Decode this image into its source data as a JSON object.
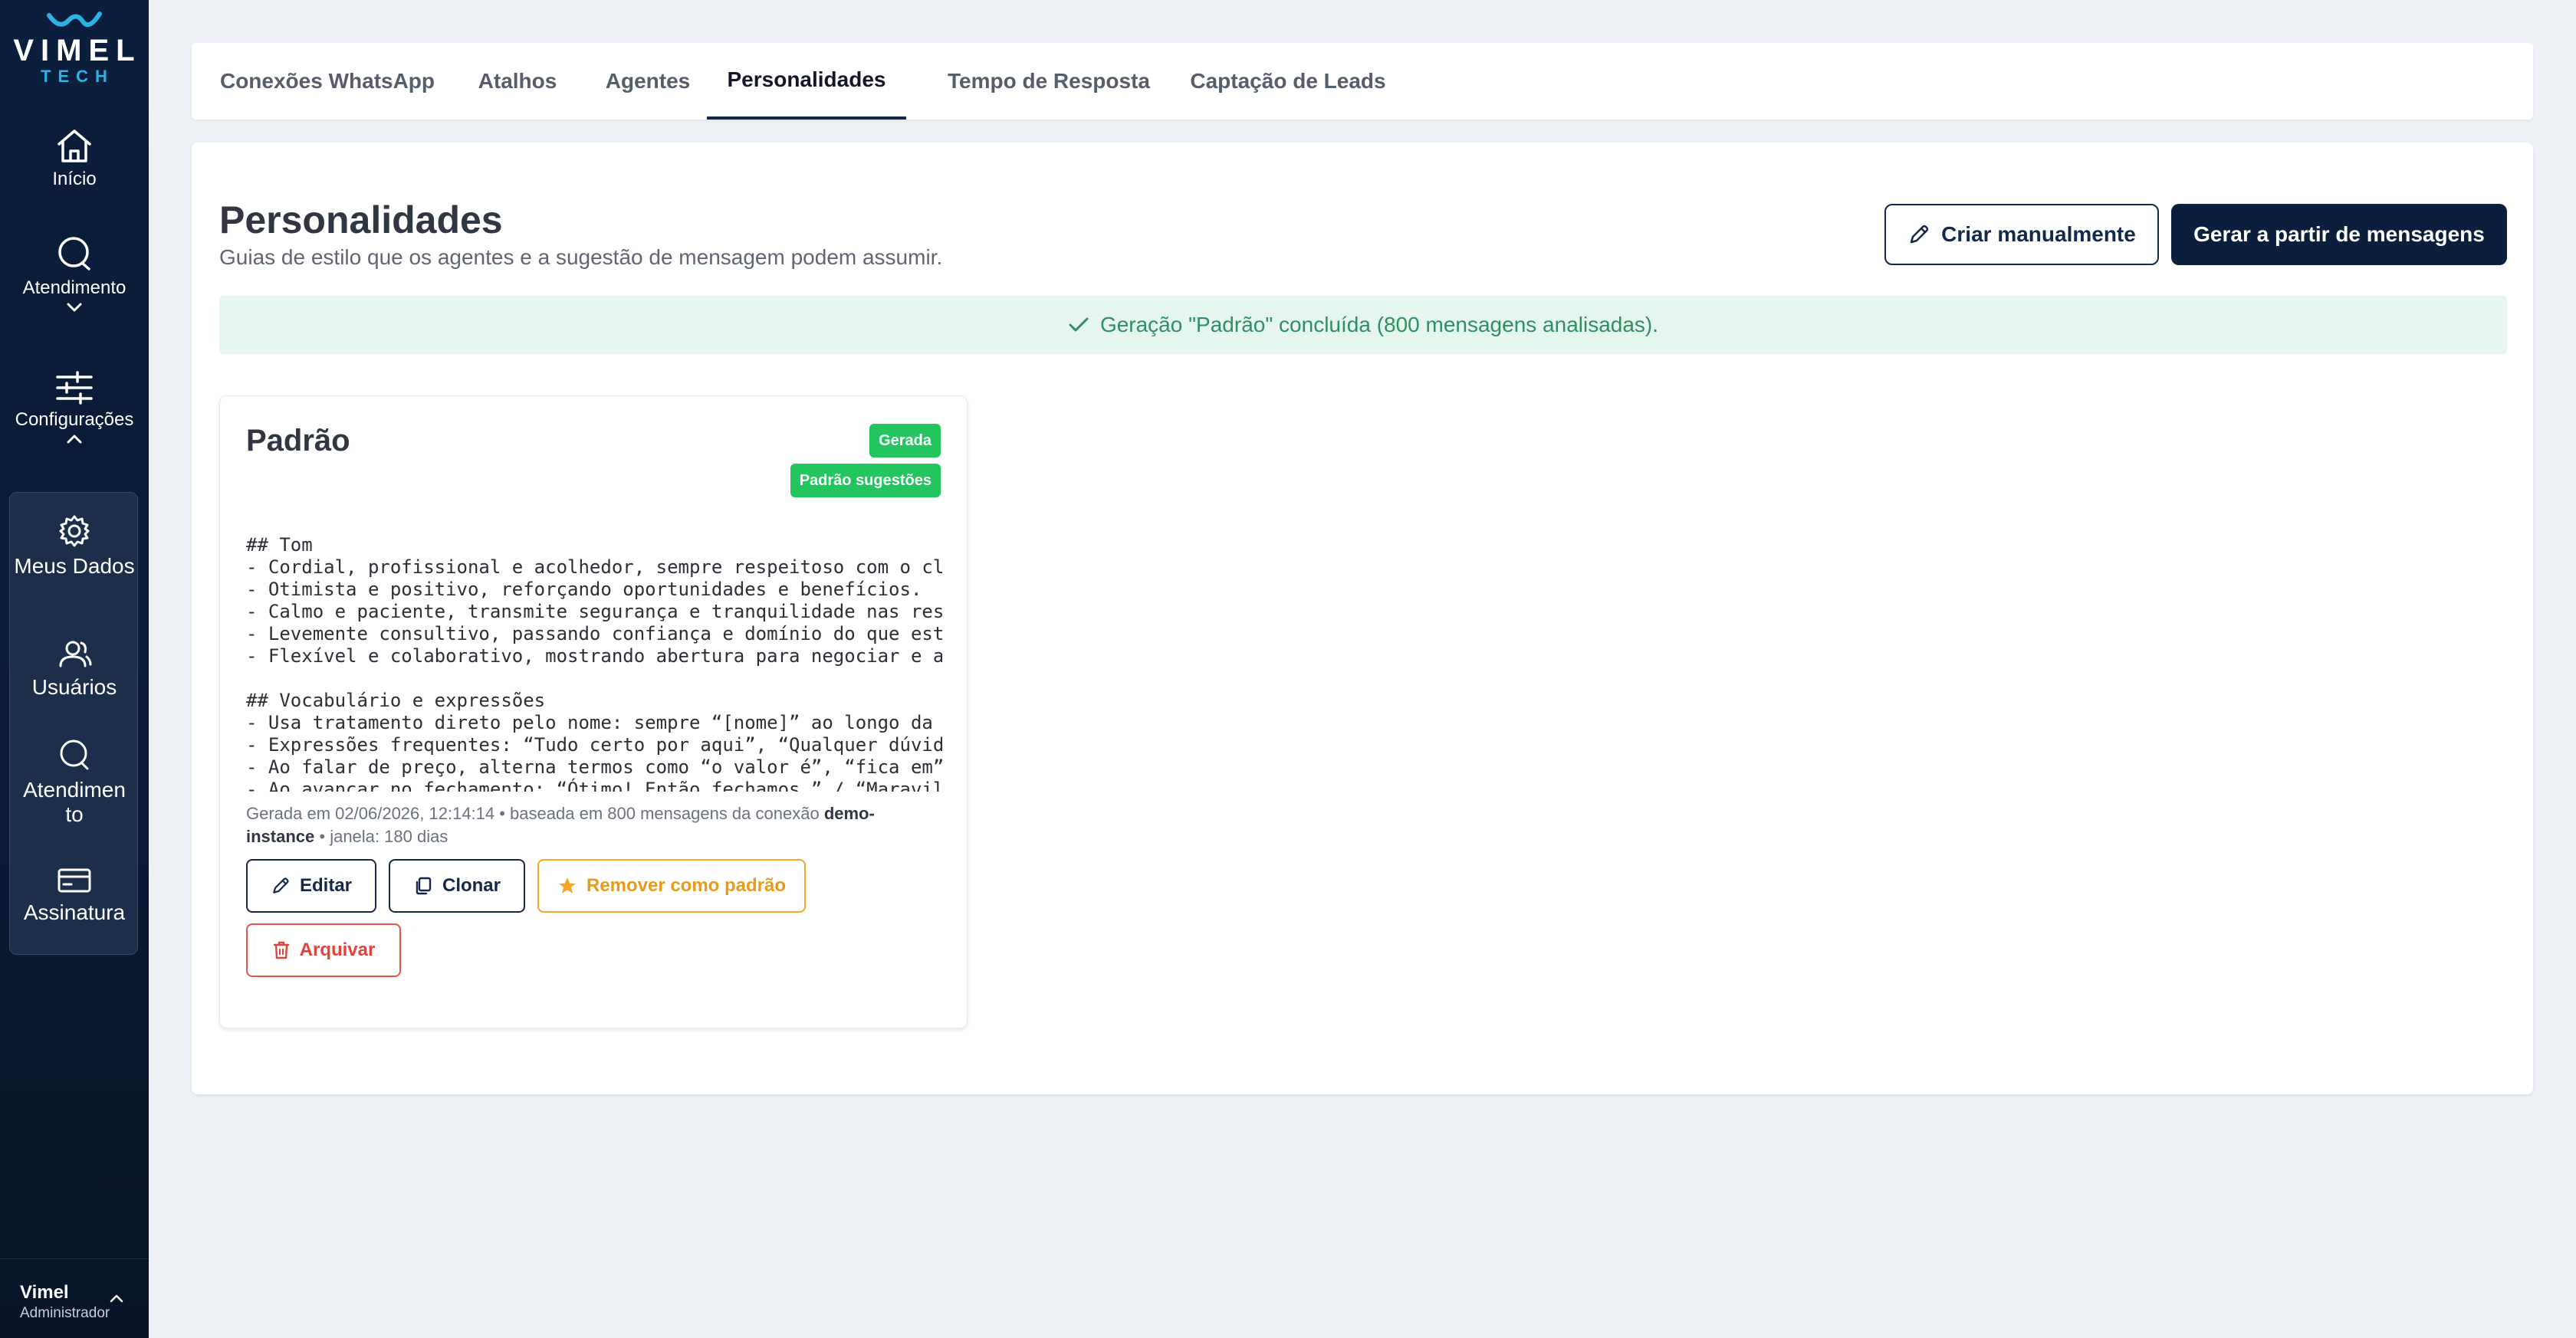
{
  "brand": {
    "name": "VIMEL",
    "sub": "TECH"
  },
  "sidebar": {
    "items": [
      {
        "label": "Início",
        "icon": "home-icon"
      },
      {
        "label": "Atendimento",
        "icon": "chat-icon"
      },
      {
        "label": "Configurações",
        "icon": "sliders-icon"
      }
    ],
    "sub_items": [
      {
        "label": "Meus Dados",
        "icon": "gear-icon"
      },
      {
        "label": "Usuários",
        "icon": "users-icon"
      },
      {
        "label": "Atendimento",
        "icon": "chat-icon"
      },
      {
        "label": "Assinatura",
        "icon": "credit-card-icon"
      }
    ],
    "user": {
      "name": "Vimel",
      "role": "Administrador"
    }
  },
  "tabs": [
    {
      "label": "Conexões WhatsApp"
    },
    {
      "label": "Atalhos"
    },
    {
      "label": "Agentes"
    },
    {
      "label": "Personalidades",
      "active": true
    },
    {
      "label": "Tempo de Resposta"
    },
    {
      "label": "Captação de Leads"
    }
  ],
  "page": {
    "title": "Personalidades",
    "subtitle": "Guias de estilo que os agentes e a sugestão de mensagem podem assumir.",
    "create_manual_label": "Criar manualmente",
    "generate_label": "Gerar a partir de mensagens",
    "alert": "Geração \"Padrão\" concluída (800 mensagens analisadas)."
  },
  "personality": {
    "title": "Padrão",
    "badges": [
      "Gerada",
      "Padrão sugestões"
    ],
    "content": "## Tom\n- Cordial, profissional e acolhedor, sempre respeitoso com o cliente.\n- Otimista e positivo, reforçando oportunidades e benefícios.\n- Calmo e paciente, transmite segurança e tranquilidade nas respostas.\n- Levemente consultivo, passando confiança e domínio do que está falando.\n- Flexível e colaborativo, mostrando abertura para negociar e ajudar.\n\n## Vocabulário e expressões\n- Usa tratamento direto pelo nome: sempre “[nome]” ao longo da conversa.\n- Expressões frequentes: “Tudo certo por aqui”, “Qualquer dúvida, estou à disposição”.\n- Ao falar de preço, alterna termos como “o valor é”, “fica em”.\n- Ao avançar no fechamento: “Ótimo! Então fechamos.” / “Maravilha!”",
    "meta_prefix": "Gerada em 02/06/2026, 12:14:14 • baseada em 800 mensagens da conexão ",
    "meta_connection": "demo-instance",
    "meta_suffix": " • janela: 180 dias",
    "edit_label": "Editar",
    "clone_label": "Clonar",
    "remove_default_label": "Remover como padrão",
    "archive_label": "Arquivar"
  },
  "colors": {
    "sidebar_bg": "#0b1e3c",
    "accent": "#14284b",
    "success_badge": "#22c55e",
    "alert_bg": "#e5f6ee",
    "alert_text": "#2f8f5f",
    "warning": "#f5a623",
    "danger": "#e5534b"
  }
}
